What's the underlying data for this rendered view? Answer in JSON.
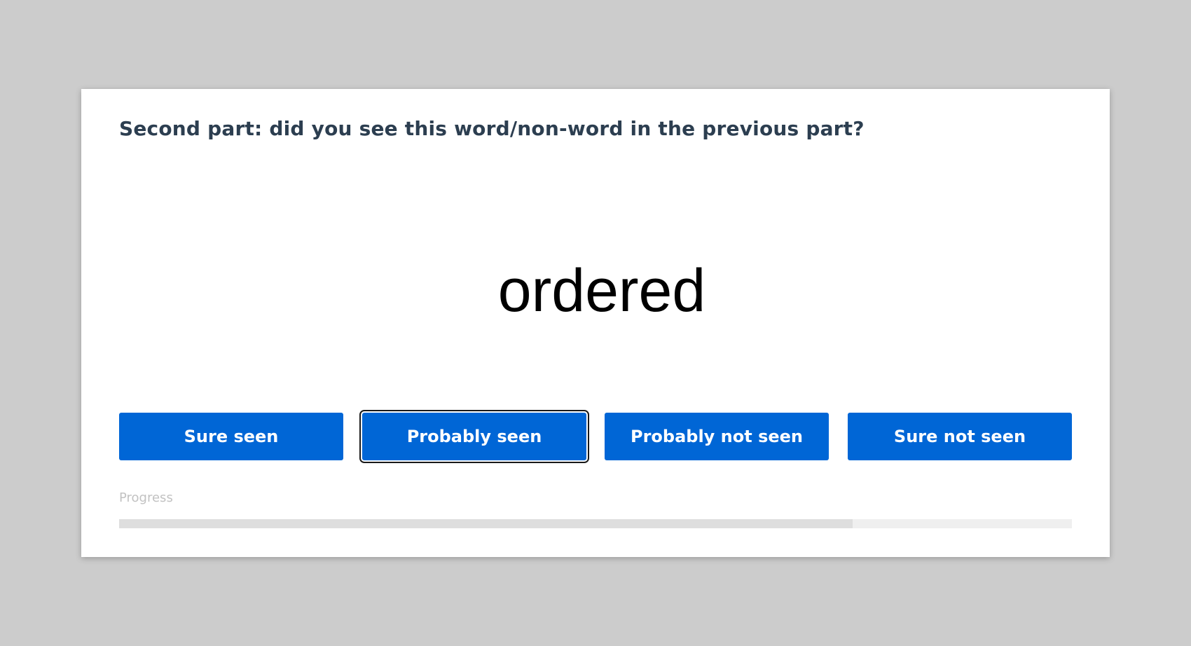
{
  "prompt": {
    "title": "Second part: did you see this word/non-word in the previous part?"
  },
  "stimulus": {
    "word": "ordered"
  },
  "responses": {
    "sure_seen": "Sure seen",
    "probably_seen": "Probably seen",
    "probably_not_seen": "Probably not seen",
    "sure_not_seen": "Sure not seen",
    "focused": "probably_seen"
  },
  "progress": {
    "label": "Progress",
    "fraction": 0.77
  },
  "colors": {
    "button_bg": "#0066d6",
    "button_text": "#ffffff",
    "title_text": "#2c3e50",
    "page_bg": "#cccccc",
    "progress_fill": "#dedede",
    "progress_track": "#efefef"
  }
}
